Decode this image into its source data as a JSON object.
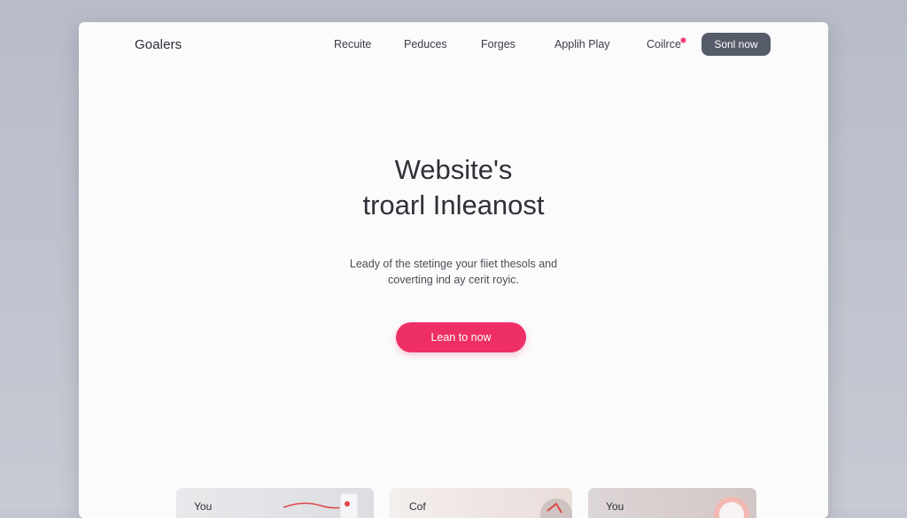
{
  "header": {
    "logo": "Goalers",
    "nav": [
      "Recuite",
      "Peduces",
      "Forges",
      "Applih Play",
      "Coilrce"
    ],
    "button": "Sonl now"
  },
  "hero": {
    "title_line1": "Website's",
    "title_line2": "troarl Inleanost",
    "subtitle_line1": "Leady of the stetinge your fiiet thesols and",
    "subtitle_line2": "coverting ind ay cerit royic.",
    "cta": "Lean to now"
  },
  "cards": [
    {
      "label": "You"
    },
    {
      "label": "Cof"
    },
    {
      "label": "You"
    }
  ],
  "colors": {
    "accent": "#ee2f66",
    "notification_dot": "#ec3b72",
    "top_button": "#555b69",
    "backdrop": "#c3c6d0"
  }
}
